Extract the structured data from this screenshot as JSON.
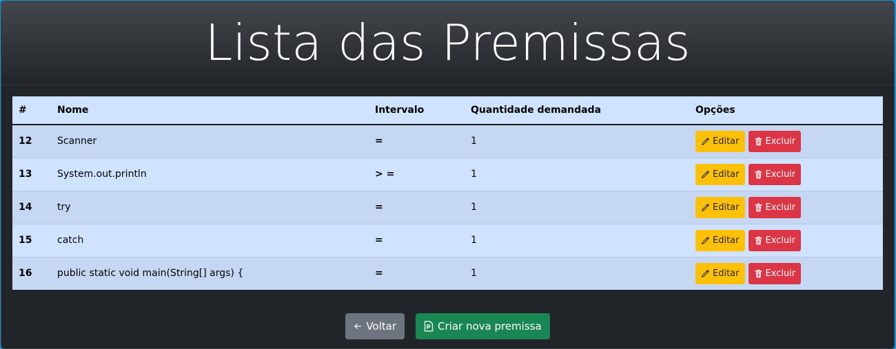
{
  "page": {
    "title": "Lista das Premissas"
  },
  "table": {
    "headers": {
      "id": "#",
      "nome": "Nome",
      "intervalo": "Intervalo",
      "quantidade": "Quantidade demandada",
      "opcoes": "Opções"
    },
    "rows": [
      {
        "id": "12",
        "nome": "Scanner",
        "intervalo": "=",
        "quantidade": "1"
      },
      {
        "id": "13",
        "nome": "System.out.println",
        "intervalo": "> =",
        "quantidade": "1"
      },
      {
        "id": "14",
        "nome": "try",
        "intervalo": "=",
        "quantidade": "1"
      },
      {
        "id": "15",
        "nome": "catch",
        "intervalo": "=",
        "quantidade": "1"
      },
      {
        "id": "16",
        "nome": "public static void main(String[] args) {",
        "intervalo": "=",
        "quantidade": "1"
      }
    ],
    "edit_label": "Editar",
    "delete_label": "Excluir"
  },
  "footer": {
    "back_label": "Voltar",
    "new_label": "Criar nova premissa"
  },
  "colors": {
    "edit": "#ffc107",
    "delete": "#dc3545",
    "back": "#6c757d",
    "new": "#198754"
  },
  "icons": {
    "edit": "pencil-icon",
    "delete": "trash-icon",
    "back": "arrow-left-icon",
    "new": "file-p-icon"
  }
}
